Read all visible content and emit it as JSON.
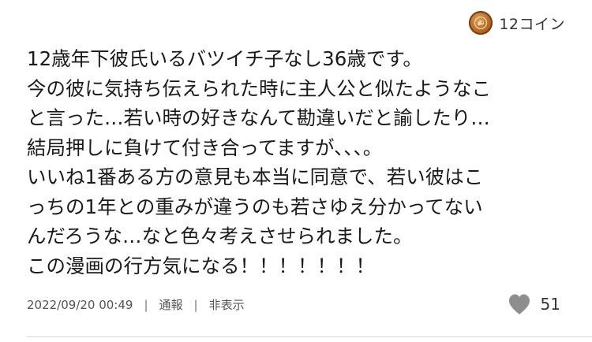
{
  "coin": {
    "icon": "coin-icon",
    "label": "12コイン"
  },
  "comment": {
    "lines": [
      "12歳年下彼氏いるバツイチ子なし36歳です。",
      "今の彼に気持ち伝えられた時に主人公と似たようなこ",
      "と言った…若い時の好きなんて勘違いだと諭したり…",
      "結局押しに負けて付き合ってますが、、、。",
      "いいね1番ある方の意見も本当に同意で、若い彼はこ",
      "っちの1年との重みが違うのも若さゆえ分かってない",
      "んだろうな…なと色々考えさせられました。",
      "この漫画の行方気になる！！！！！！！"
    ]
  },
  "meta": {
    "timestamp": "2022/09/20 00:49",
    "separator": "|",
    "report_label": "通報",
    "hide_label": "非表示"
  },
  "likes": {
    "icon": "heart-icon",
    "count": "51"
  },
  "colors": {
    "text": "#1a1a1a",
    "meta_text": "#555555",
    "heart": "#8e8e8e",
    "coin": "#b86a24",
    "divider": "#d4d4d4"
  }
}
